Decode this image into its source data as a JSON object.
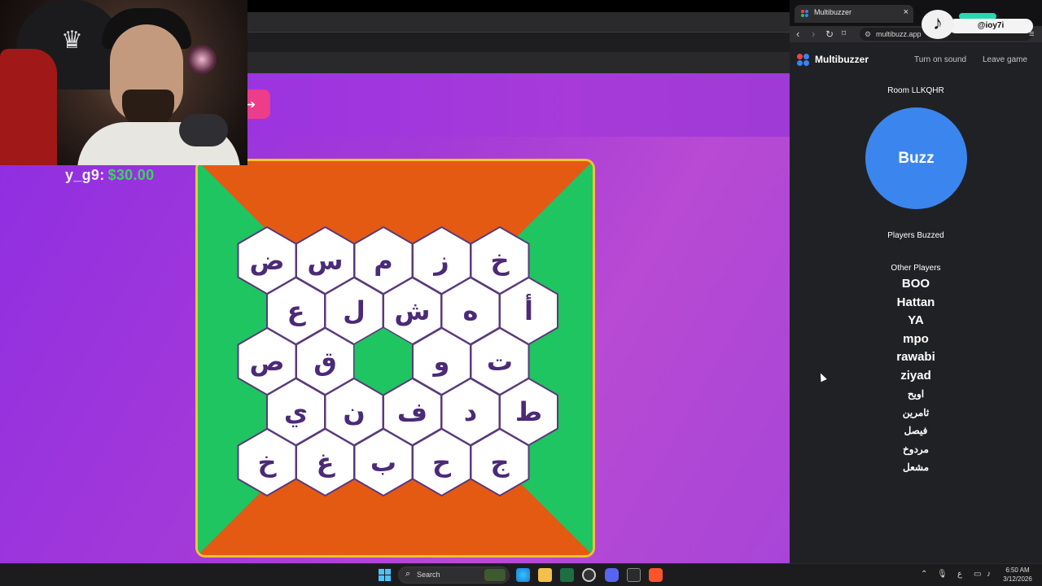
{
  "donation": {
    "user": "y_g9:",
    "amount": "$30.00"
  },
  "board": {
    "colors": {
      "green": "#1ec561",
      "orange": "#e55a12",
      "border": "#f5c22c",
      "tile": "#ffffff",
      "tile_stroke": "#5a3a7a",
      "letter": "#4b2a78"
    },
    "rows": [
      [
        "ض",
        "س",
        "م",
        "ز",
        "خ"
      ],
      [
        "ع",
        "ل",
        "ش",
        "ه",
        "أ"
      ],
      [
        "ص",
        "ق",
        "",
        "و",
        "ت"
      ],
      [
        "ي",
        "ن",
        "ف",
        "د",
        "ط"
      ],
      [
        "خ",
        "غ",
        "ب",
        "ح",
        "ج"
      ]
    ]
  },
  "browser": {
    "tab_title": "Multibuzzer",
    "tab_close": "×",
    "url": "multibuzz.app",
    "nav": {
      "back": "‹",
      "forward": "›",
      "reload": "↻"
    }
  },
  "tiktok": {
    "handle": "@ioy7i",
    "logo": "♪"
  },
  "app": {
    "brand": "Multibuzzer",
    "turn_on_sound": "Turn on sound",
    "leave_game": "Leave game",
    "room": "Room LLKQHR",
    "buzz": "Buzz",
    "players_buzzed": "Players Buzzed",
    "other_players": "Other Players",
    "players": [
      "BOO",
      "Hattan",
      "YA",
      "mpo",
      "rawabi",
      "ziyad",
      "اويح",
      "ثامرين",
      "فيصل",
      "مردوخ",
      "مشعل"
    ],
    "logo_colors": [
      "#ef4444",
      "#3b82f6",
      "#22c55e",
      "#f59e0b"
    ]
  },
  "taskbar": {
    "search_placeholder": "Search",
    "lang": "ع",
    "time": "6:50 AM",
    "date": "3/12/2026"
  }
}
